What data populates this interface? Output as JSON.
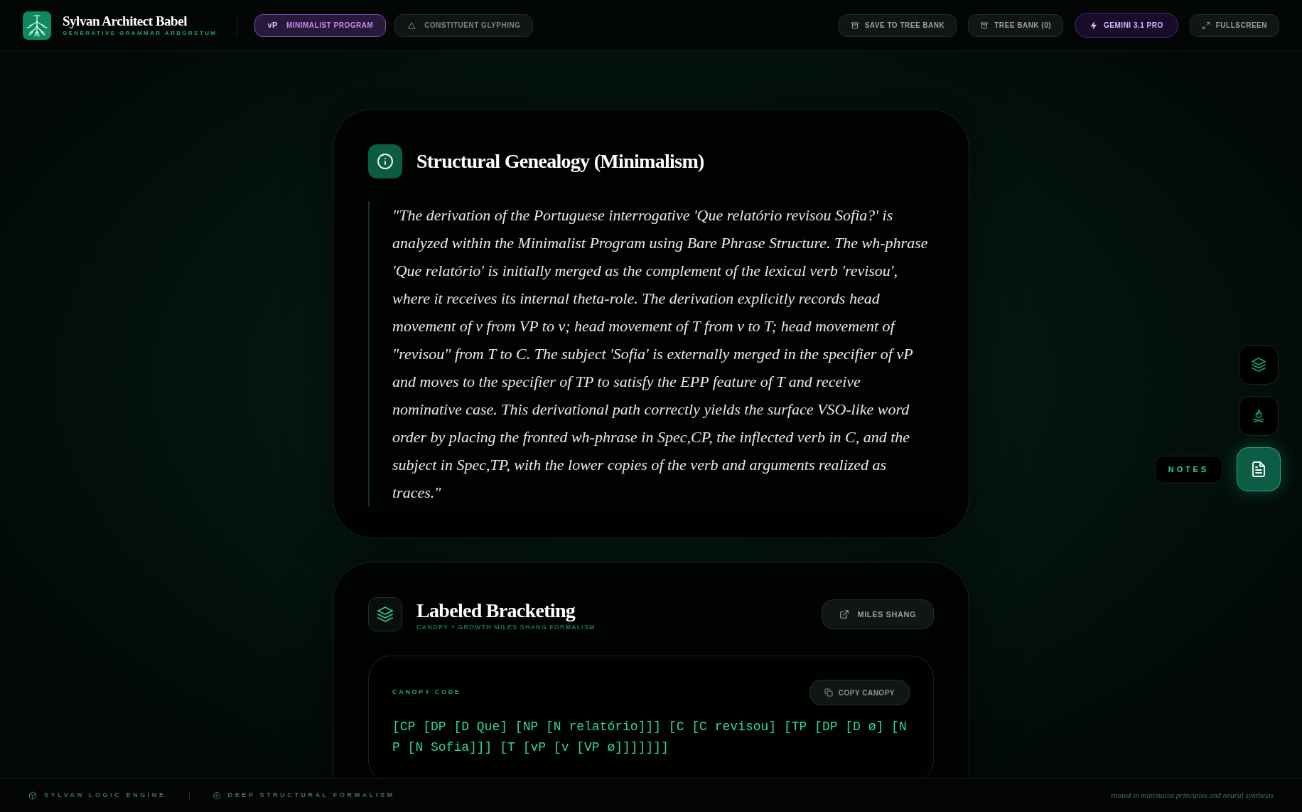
{
  "app": {
    "title": "Sylvan Architect Babel",
    "subtitle": "GENERATIVE GRAMMAR ARBORETUM"
  },
  "mode_tabs": [
    {
      "badge": "vP",
      "label": "MINIMALIST PROGRAM",
      "selected": true
    },
    {
      "label": "CONSTITUENT GLYPHING",
      "selected": false
    }
  ],
  "toolbar": [
    {
      "kind": "archive",
      "label": "SAVE TO TREE BANK"
    },
    {
      "kind": "archive",
      "label": "TREE BANK (0)"
    },
    {
      "kind": "model",
      "label": "GEMINI 3.1 PRO"
    },
    {
      "kind": "fullscreen",
      "label": "FULLSCREEN"
    }
  ],
  "cards": [
    {
      "kind": "quote",
      "title": "Structural Genealogy (Minimalism)",
      "quote": "\"The derivation of the Portuguese interrogative 'Que relatório revisou Sofia?' is analyzed within the Minimalist Program using Bare Phrase Structure. The wh-phrase 'Que relatório' is initially merged as the complement of the lexical verb 'revisou', where it receives its internal theta-role. The derivation explicitly records head movement of v from VP to v; head movement of T from v to T; head movement of \"revisou\" from T to C. The subject 'Sofia' is externally merged in the specifier of vP and moves to the specifier of TP to satisfy the EPP feature of T and receive nominative case. This derivational path correctly yields the surface VSO-like word order by placing the fronted wh-phrase in Spec,CP, the inflected verb in C, and the subject in Spec,TP, with the lower copies of the verb and arguments realized as traces.\""
    },
    {
      "kind": "bracketing",
      "title": "Labeled Bracketing",
      "subtitle": "CANOPY + GROWTH MILES SHANG FORMALISM",
      "link_button": "MILES SHANG",
      "code_panel": {
        "label": "CANOPY CODE",
        "copy_button": "COPY CANOPY",
        "code": "[CP [DP [D Que] [NP [N relatório]]] [C [C revisou] [TP [DP [D ø] [NP [N Sofia]]] [T [vP [v [VP ø]]]]]]]"
      }
    }
  ],
  "side_rail": [
    {
      "kind": "layers",
      "selected": false
    },
    {
      "kind": "campfire",
      "selected": false
    },
    {
      "kind": "notes",
      "selected": true,
      "tooltip": "NOTES"
    }
  ],
  "footer": {
    "items": [
      {
        "kind": "cube",
        "label": "SYLVAN LOGIC ENGINE"
      },
      {
        "kind": "ring",
        "label": "DEEP STRUCTURAL FORMALISM"
      }
    ],
    "tagline": "rooted in minimalist principles and neural synthesis"
  }
}
